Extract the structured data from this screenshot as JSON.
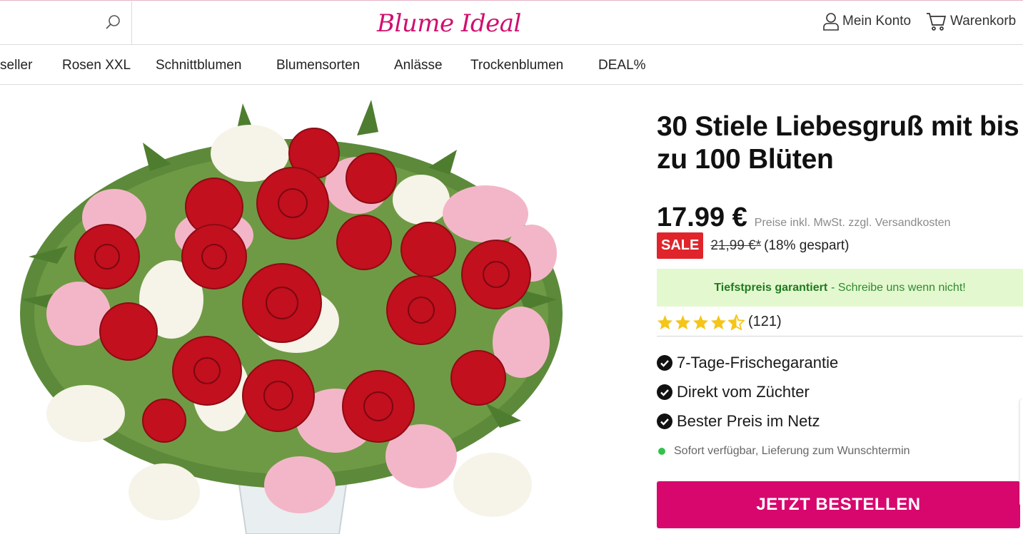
{
  "header": {
    "logo_text": "Blume Ideal",
    "brand_color": "#d10f6f",
    "search_icon": "search-icon",
    "account_label": "Mein Konto",
    "cart_label": "Warenkorb"
  },
  "nav": {
    "items": [
      {
        "label": "seller"
      },
      {
        "label": "Rosen XXL"
      },
      {
        "label": "Schnittblumen"
      },
      {
        "label": "Blumensorten"
      },
      {
        "label": "Anlässe"
      },
      {
        "label": "Trockenblumen"
      },
      {
        "label": "DEAL%"
      }
    ]
  },
  "product": {
    "title": "30 Stiele Liebesgruß mit bis zu 100 Blüten",
    "price": "17.99 €",
    "price_note": "Preise inkl. MwSt. zzgl. Versandkosten",
    "sale_badge": "SALE",
    "old_price": "21,99 €*",
    "saved": "(18% gespart)",
    "tiefstpreis_strong": "Tiefstpreis garantiert",
    "tiefstpreis_rest": "- Schreibe uns wenn nicht!",
    "rating_value": 4.5,
    "rating_max": 5,
    "rating_count": "(121)",
    "usps": [
      {
        "label": "7-Tage-Frischegarantie"
      },
      {
        "label": "Direkt vom Züchter"
      },
      {
        "label": "Bester Preis im Netz"
      }
    ],
    "availability": "Sofort verfügbar, Lieferung zum Wunschtermin",
    "order_button": "JETZT BESTELLEN"
  },
  "colors": {
    "accent": "#d8076e",
    "sale": "#e0242b",
    "success_bg": "#e4f8cf",
    "success_text": "#1f7a1f",
    "star": "#f5c518",
    "availability_dot": "#33c24d"
  }
}
